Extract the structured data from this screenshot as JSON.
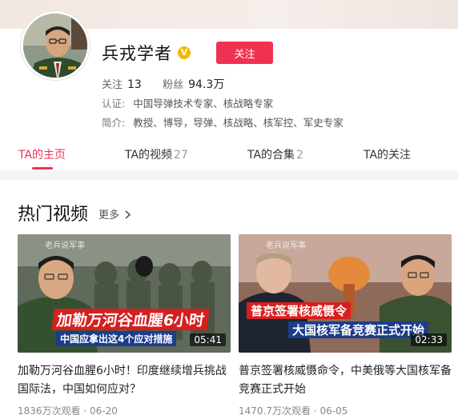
{
  "profile": {
    "name": "兵戎学者",
    "follow_label": "关注",
    "following_label": "关注",
    "following_count": "13",
    "fans_label": "粉丝",
    "fans_count": "94.3万",
    "cert_label": "认证:",
    "cert_value": "中国导弹技术专家、核战略专家",
    "bio_label": "简介:",
    "bio_value": "教授、博导，导弹、核战略、核军控、军史专家"
  },
  "tabs": [
    {
      "label": "TA的主页",
      "count": ""
    },
    {
      "label": "TA的视频",
      "count": "27"
    },
    {
      "label": "TA的合集",
      "count": "2"
    },
    {
      "label": "TA的关注",
      "count": ""
    }
  ],
  "section": {
    "title": "热门视频",
    "more_label": "更多",
    "more_icon": "chevron-right-icon"
  },
  "videos": [
    {
      "watermark": "老兵说军事",
      "overlay_main": "加勒万河谷血腥6小时",
      "overlay_sub": "中国应拿出这4个应对措施",
      "duration": "05:41",
      "title": "加勒万河谷血腥6小时！印度继续增兵挑战国际法，中国如何应对？",
      "views": "1836万次观看",
      "date": "06-20"
    },
    {
      "watermark": "老兵说军事",
      "overlay_main": "普京签署核威慑令",
      "overlay_sub": "大国核军备竞赛正式开始",
      "duration": "02:33",
      "title": "普京签署核威慑命令，中美俄等大国核军备竞赛正式开始",
      "views": "1470.7万次观看",
      "date": "06-05"
    }
  ],
  "colors": {
    "accent": "#ef3152",
    "verified": "#f5b800",
    "overlay_red": "#d71f1f",
    "overlay_blue": "#1c3d8c"
  }
}
